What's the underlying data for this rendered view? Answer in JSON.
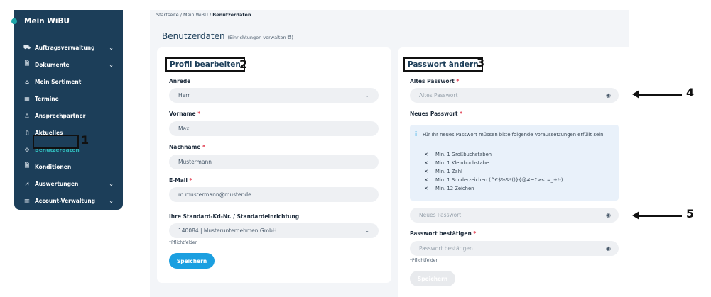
{
  "sidebar": {
    "title": "Mein WiBU",
    "items": [
      {
        "label": "Auftragsverwaltung",
        "icon": "truck-icon",
        "chevron": true
      },
      {
        "label": "Dokumente",
        "icon": "document-icon",
        "chevron": true
      },
      {
        "label": "Mein Sortiment",
        "icon": "bag-icon",
        "chevron": false
      },
      {
        "label": "Termine",
        "icon": "calendar-icon",
        "chevron": false
      },
      {
        "label": "Ansprechpartner",
        "icon": "person-icon",
        "chevron": false
      },
      {
        "label": "Aktuelles",
        "icon": "bell-icon",
        "chevron": false
      },
      {
        "label": "Benutzerdaten",
        "icon": "gear-icon",
        "chevron": false,
        "active": true
      },
      {
        "label": "Konditionen",
        "icon": "document-icon",
        "chevron": false
      },
      {
        "label": "Auswertungen",
        "icon": "chart-icon",
        "chevron": true
      },
      {
        "label": "Account-Verwaltung",
        "icon": "building-icon",
        "chevron": true
      }
    ]
  },
  "breadcrumb": {
    "home": "Startseite",
    "sep": "/",
    "parent": "Mein WiBU",
    "current": "Benutzerdaten"
  },
  "page": {
    "title": "Benutzerdaten",
    "subtitle": "(Einrichtungen verwalten",
    "subtitle_end": ")"
  },
  "annotations": {
    "n1": "1",
    "n2": "2",
    "n3": "3",
    "n4": "4",
    "n5": "5"
  },
  "profile": {
    "title": "Profil bearbeiten",
    "anrede_label": "Anrede",
    "anrede_value": "Herr",
    "vorname_label": "Vorname",
    "vorname_value": "Max",
    "nachname_label": "Nachname",
    "nachname_value": "Mustermann",
    "email_label": "E-Mail",
    "email_value": "m.mustermann@muster.de",
    "kdnr_label": "Ihre Standard-Kd-Nr. / Standardeinrichtung",
    "kdnr_value": "140084 | Musterunternehmen GmbH",
    "required_note": "*Pflichtfelder",
    "save": "Speichern"
  },
  "password": {
    "title": "Passwort ändern",
    "old_label": "Altes Passwort",
    "old_placeholder": "Altes Passwort",
    "new_label": "Neues Passwort",
    "info": "Für Ihr neues Passwort müssen bitte folgende Voraussetzungen erfüllt sein",
    "requirements": [
      "Min. 1 Großbuchstaben",
      "Min. 1 Kleinbuchstabe",
      "Min. 1 Zahl",
      "Min. 1 Sonderzeichen (^€$%&*()}{@#~?><|=_+!-)",
      "Min. 12 Zeichen"
    ],
    "new_placeholder": "Neues Passwort",
    "confirm_label": "Passwort bestätigen",
    "confirm_placeholder": "Passwort bestätigen",
    "required_note": "*Pflichtfelder",
    "save": "Speichern"
  },
  "colors": {
    "sidebar": "#1c3e59",
    "accent": "#1b9fe0",
    "active": "#2fb7b8",
    "required": "#e0384b"
  }
}
